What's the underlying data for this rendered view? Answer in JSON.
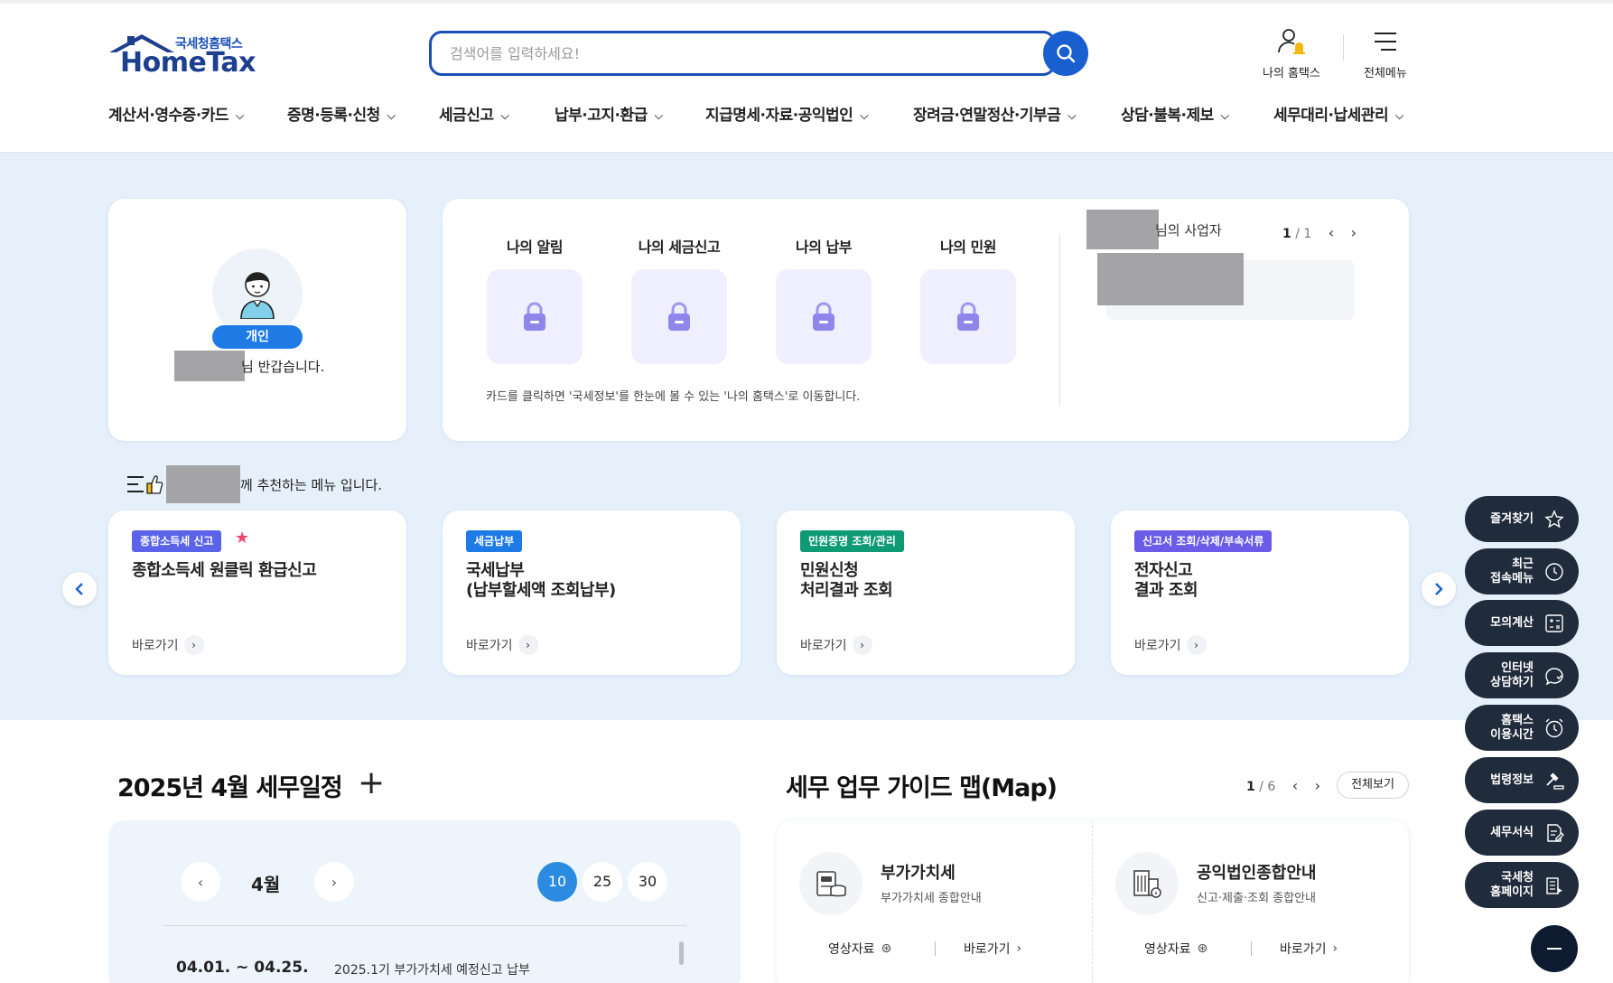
{
  "header": {
    "logo_ko": "국세청홈택스",
    "logo_en": "HomeTax",
    "search_placeholder": "검색어를 입력하세요!",
    "my_hometax": "나의 홈택스",
    "all_menu": "전체메뉴"
  },
  "gnb": [
    "계산서·영수증·카드",
    "증명·등록·신청",
    "세금신고",
    "납부·고지·환급",
    "지급명세·자료·공익법인",
    "장려금·연말정산·기부금",
    "상담·불복·제보",
    "세무대리·납세관리"
  ],
  "profile": {
    "badge": "개인",
    "greeting_suffix": "님 반갑습니다."
  },
  "my_panel": {
    "cards": [
      "나의 알림",
      "나의 세금신고",
      "나의 납부",
      "나의 민원"
    ],
    "note": "카드를 클릭하면 '국세정보'를 한눈에 볼 수 있는 '나의 홈택스'로 이동합니다.",
    "business_suffix": "님의 사업자",
    "pager_current": "1",
    "pager_total": "/ 1"
  },
  "recommend": {
    "title_suffix": "께 추천하는 메뉴 입니다.",
    "go_label": "바로가기",
    "cards": [
      {
        "tag": "종합소득세 신고",
        "tag_color": "#5b63e8",
        "title": "종합소득세 원클릭 환급신고",
        "starred": true
      },
      {
        "tag": "세금납부",
        "tag_color": "#1e7be5",
        "title": "국세납부\n(납부할세액 조회납부)",
        "starred": false
      },
      {
        "tag": "민원증명 조회/관리",
        "tag_color": "#0e9a74",
        "title": "민원신청\n처리결과 조회",
        "starred": false
      },
      {
        "tag": "신고서 조회/삭제/부속서류",
        "tag_color": "#6a5be8",
        "title": "전자신고\n결과 조회",
        "starred": false
      }
    ]
  },
  "schedule": {
    "title": "2025년 4월 세무일정",
    "month": "4월",
    "days": [
      "10",
      "25",
      "30"
    ],
    "selected_day": "10",
    "entries": [
      {
        "date": "04.01. ~ 04.25.",
        "desc": "2025.1기 부가가치세 예정신고 납부"
      }
    ]
  },
  "guide": {
    "title": "세무 업무 가이드 맵(Map)",
    "pager_current": "1",
    "pager_total": "/ 6",
    "view_all": "전체보기",
    "items": [
      {
        "name": "부가가치세",
        "sub": "부가가치세 종합안내",
        "video": "영상자료",
        "go": "바로가기"
      },
      {
        "name": "공익법인종합안내",
        "sub": "신고·제출·조회 종합안내",
        "video": "영상자료",
        "go": "바로가기"
      }
    ]
  },
  "quick_menu": [
    {
      "label": "즐겨찾기",
      "icon": "star-icon"
    },
    {
      "label": "최근\n접속메뉴",
      "icon": "clock-icon"
    },
    {
      "label": "모의계산",
      "icon": "calculator-icon"
    },
    {
      "label": "인터넷\n상담하기",
      "icon": "chat-icon"
    },
    {
      "label": "홈택스\n이용시간",
      "icon": "alarm-icon"
    },
    {
      "label": "법령정보",
      "icon": "gavel-icon"
    },
    {
      "label": "세무서식",
      "icon": "form-icon"
    },
    {
      "label": "국세청\n홈페이지",
      "icon": "building-icon"
    }
  ],
  "colors": {
    "brand": "#1a4fb8",
    "hero_bg": "#e5f0fb",
    "quick_bg": "#202b3c"
  }
}
